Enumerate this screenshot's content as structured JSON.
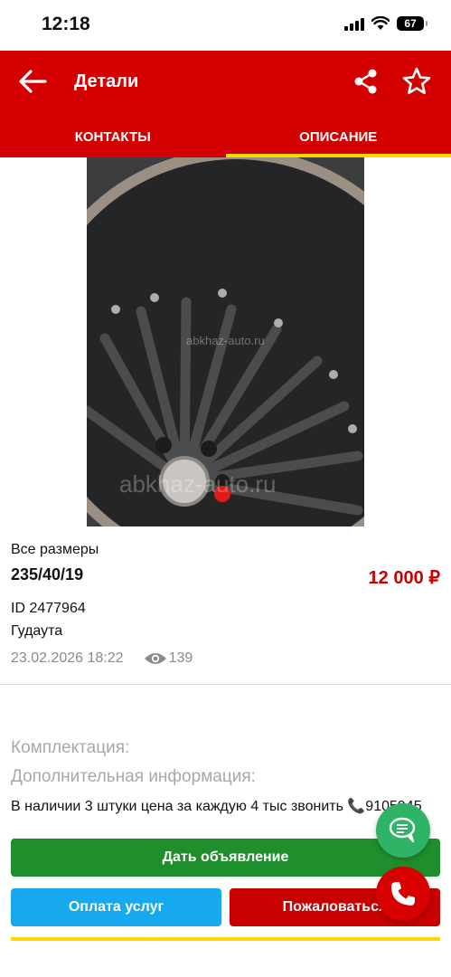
{
  "status_bar": {
    "time": "12:18",
    "battery": "67"
  },
  "header": {
    "title": "Детали",
    "back_icon": "arrow-left-icon",
    "share_icon": "share-icon",
    "favorite_icon": "star-outline-icon"
  },
  "tabs": [
    {
      "label": "КОНТАКТЫ",
      "active": false
    },
    {
      "label": "ОПИСАНИЕ",
      "active": true
    }
  ],
  "photo": {
    "watermark": "abkhaz-auto.ru"
  },
  "listing": {
    "category": "Все размеры",
    "size": "235/40/19",
    "price": "12 000 ₽",
    "id": "ID 2477964",
    "city": "Гудаута",
    "date": "23.02.2026 18:22",
    "views": "139"
  },
  "details": {
    "kit_label": "Комплектация:",
    "extra_label": "Дополнительная информация:",
    "text": "В наличии 3 штуки цена за каждую 4 тыс звонить 📞9105945"
  },
  "buttons": {
    "post": "Дать объявление",
    "pay": "Оплата услуг",
    "report": "Пожаловаться"
  },
  "colors": {
    "brand": "#d40000",
    "accent": "#ffd600",
    "green": "#1f8f2e",
    "blue": "#16a9ef",
    "price": "#cc0000"
  }
}
